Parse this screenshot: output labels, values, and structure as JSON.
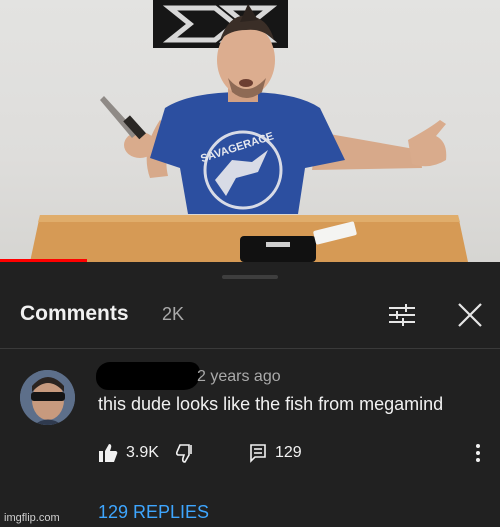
{
  "comments_panel": {
    "title": "Comments",
    "count": "2K",
    "filter_icon": "sort-filter-icon",
    "close_icon": "close-icon"
  },
  "video": {
    "description": "",
    "shirt_text": "SAVAGERACE",
    "progress_color": "#ff0000"
  },
  "comment": {
    "author_redacted": true,
    "time": "2 years ago",
    "text": "this dude looks like the fish from megamind",
    "likes": "3.9K",
    "reply_count": "129",
    "replies_label": "129 REPLIES"
  },
  "icons": {
    "like": "thumbs-up-icon",
    "dislike": "thumbs-down-icon",
    "replies": "comment-icon",
    "more": "more-vert-icon"
  },
  "watermark": "imgflip.com",
  "colors": {
    "panel_bg": "#212121",
    "link_blue": "#3ea6ff",
    "text": "#f1f1f1",
    "muted": "#aaaaaa"
  }
}
